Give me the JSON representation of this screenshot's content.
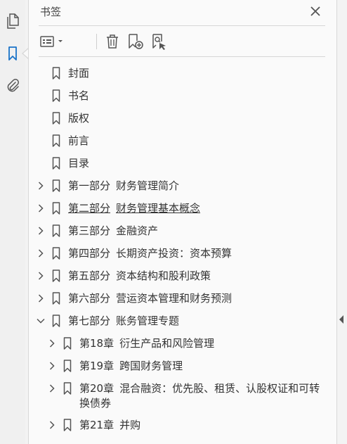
{
  "panel": {
    "title": "书签"
  },
  "toolbar": {
    "options_icon": "bookmark-options-icon",
    "delete_icon": "trash-icon",
    "new_icon": "new-bookmark-icon",
    "find_icon": "find-bookmark-icon"
  },
  "sidebar_tools": [
    "pages-icon",
    "bookmark-icon",
    "attachment-icon"
  ],
  "colors": {
    "accent": "#1a73c8",
    "text": "#333333",
    "panel_bg": "#fafafa"
  },
  "bookmarks": [
    {
      "label": "封面"
    },
    {
      "label": "书名"
    },
    {
      "label": "版权"
    },
    {
      "label": "前言"
    },
    {
      "label": "目录"
    },
    {
      "part": "第一部分",
      "title": "财务管理简介",
      "state": "collapsed"
    },
    {
      "part": "第二部分",
      "title": "财务管理基本概念",
      "state": "collapsed",
      "hover": true
    },
    {
      "part": "第三部分",
      "title": "金融资产",
      "state": "collapsed"
    },
    {
      "part": "第四部分",
      "title": "长期资产投资：资本预算",
      "state": "collapsed"
    },
    {
      "part": "第五部分",
      "title": "资本结构和股利政策",
      "state": "collapsed"
    },
    {
      "part": "第六部分",
      "title": "营运资本管理和财务预测",
      "state": "collapsed"
    },
    {
      "part": "第七部分",
      "title": "账务管理专题",
      "state": "expanded",
      "children": [
        {
          "part": "第18章",
          "title": "衍生产品和风险管理",
          "state": "collapsed"
        },
        {
          "part": "第19章",
          "title": "跨国财务管理",
          "state": "collapsed"
        },
        {
          "part": "第20章",
          "title": "混合融资：优先股、租赁、认股权证和可转换债券",
          "state": "collapsed"
        },
        {
          "part": "第21章",
          "title": "并购",
          "state": "collapsed"
        }
      ]
    }
  ]
}
